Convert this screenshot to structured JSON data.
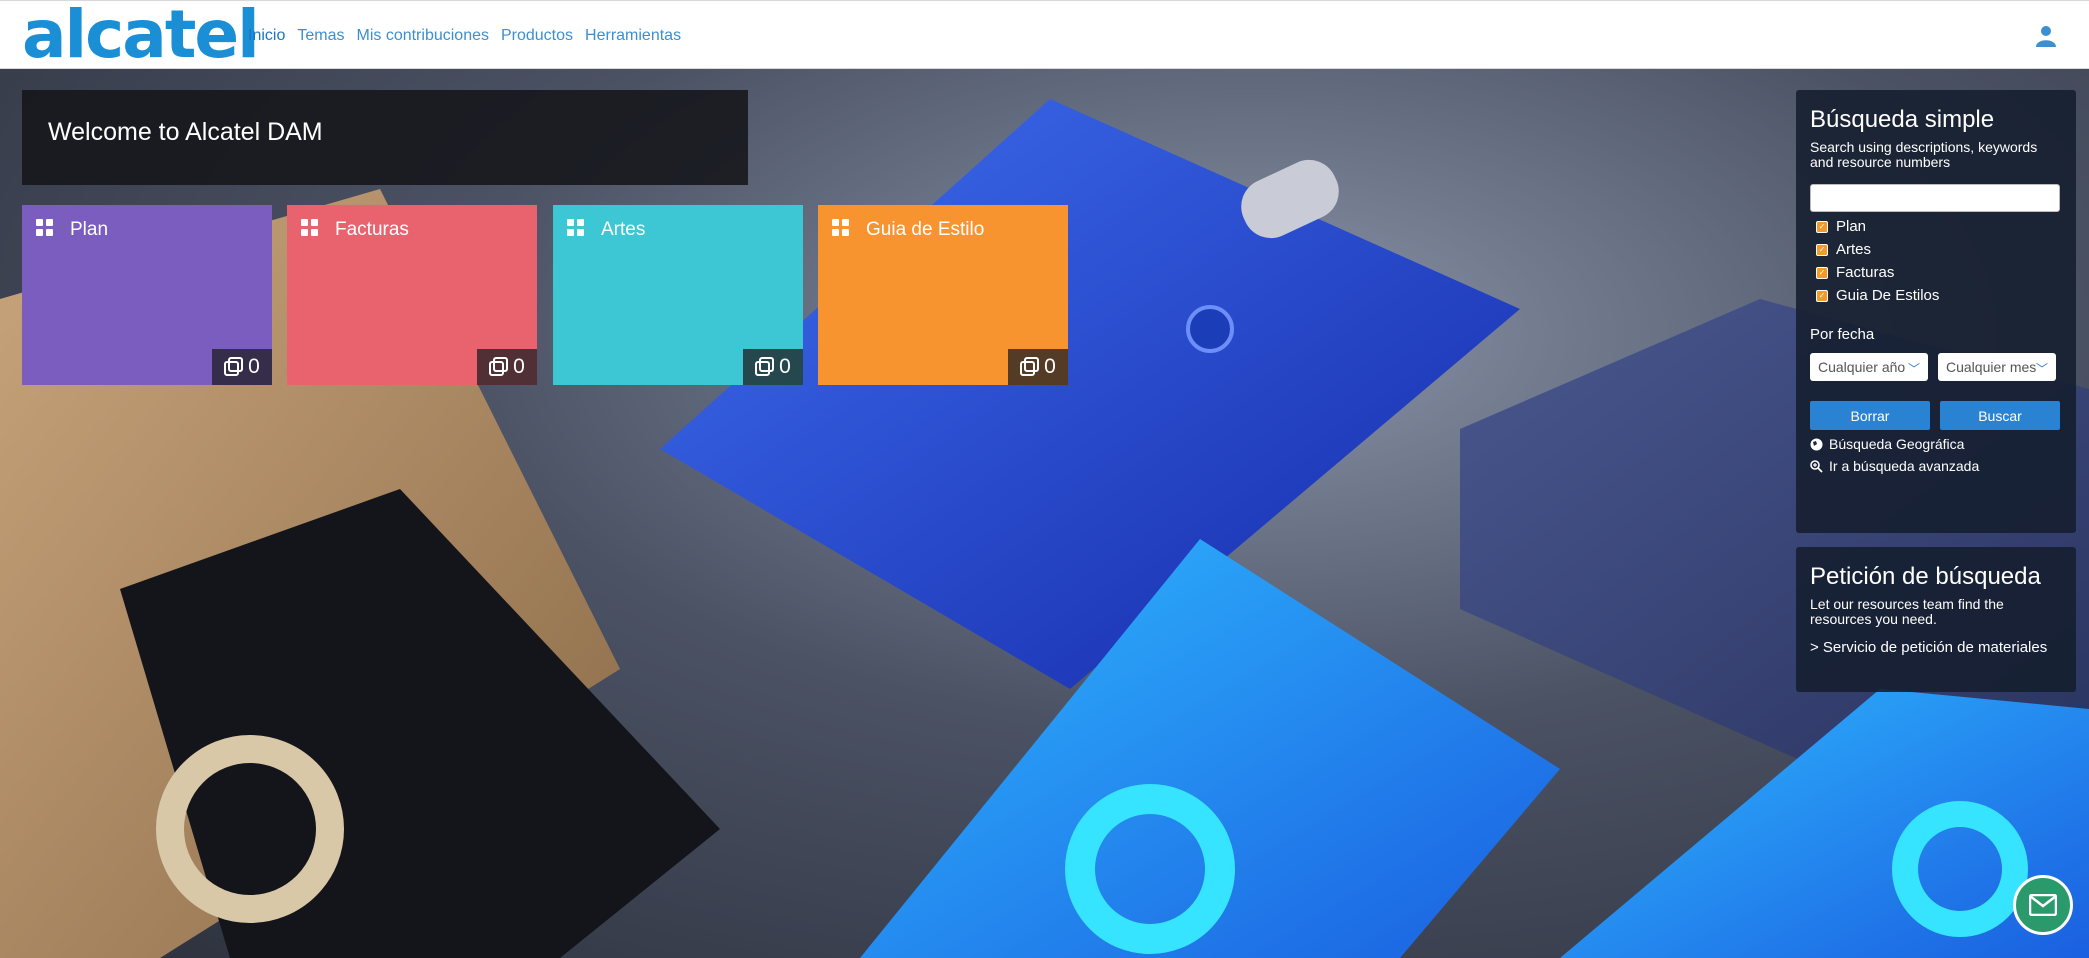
{
  "brand": {
    "logo_text": "alcatel"
  },
  "nav": {
    "items": [
      {
        "label": "Inicio",
        "active": true
      },
      {
        "label": "Temas",
        "active": false
      },
      {
        "label": "Mis contribuciones",
        "active": false
      },
      {
        "label": "Productos",
        "active": false
      },
      {
        "label": "Herramientas",
        "active": false
      }
    ],
    "user_icon": "user-icon"
  },
  "welcome": {
    "title": "Welcome to Alcatel DAM"
  },
  "tiles": [
    {
      "label": "Plan",
      "count": "0",
      "color": "#7b5cbf"
    },
    {
      "label": "Facturas",
      "count": "0",
      "color": "#e8636e"
    },
    {
      "label": "Artes",
      "count": "0",
      "color": "#3dc6d4"
    },
    {
      "label": "Guia de Estilo",
      "count": "0",
      "color": "#f79430"
    }
  ],
  "simple_search": {
    "title": "Búsqueda simple",
    "subtitle": "Search using descriptions, keywords and resource numbers",
    "input_value": "",
    "checkboxes": [
      {
        "label": "Plan",
        "checked": true
      },
      {
        "label": "Artes",
        "checked": true
      },
      {
        "label": "Facturas",
        "checked": true
      },
      {
        "label": "Guia De Estilos",
        "checked": true
      }
    ],
    "date_label": "Por fecha",
    "year_select": "Cualquier año",
    "month_select": "Cualquier mes",
    "clear_label": "Borrar",
    "search_label": "Buscar",
    "geo_link": "Búsqueda Geográfica",
    "advanced_link": "Ir a búsqueda avanzada"
  },
  "request": {
    "title": "Petición de búsqueda",
    "subtitle": "Let our resources team find the resources you need.",
    "link": "> Servicio de petición de materiales"
  },
  "colors": {
    "accent": "#2a82d2",
    "checkbox": "#f39a2b",
    "mail": "#2a9a6c"
  }
}
